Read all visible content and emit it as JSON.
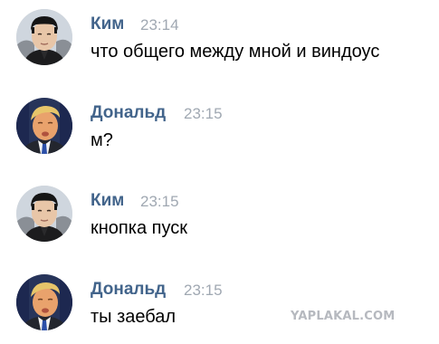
{
  "messages": [
    {
      "author": "Ким",
      "time": "23:14",
      "text": "что общего между мной и виндоус",
      "avatar_icon": "kim-avatar-icon"
    },
    {
      "author": "Дональд",
      "time": "23:15",
      "text": "м?",
      "avatar_icon": "donald-avatar-icon"
    },
    {
      "author": "Ким",
      "time": "23:15",
      "text": "кнопка пуск",
      "avatar_icon": "kim-avatar-icon"
    },
    {
      "author": "Дональд",
      "time": "23:15",
      "text": "ты заебал",
      "avatar_icon": "donald-avatar-icon"
    }
  ],
  "watermark": "YAPLAKAL.COM",
  "colors": {
    "author": "#42648b",
    "time": "#a0a8b2",
    "text": "#000000",
    "background": "#ffffff",
    "watermark": "#b6b9bf"
  }
}
